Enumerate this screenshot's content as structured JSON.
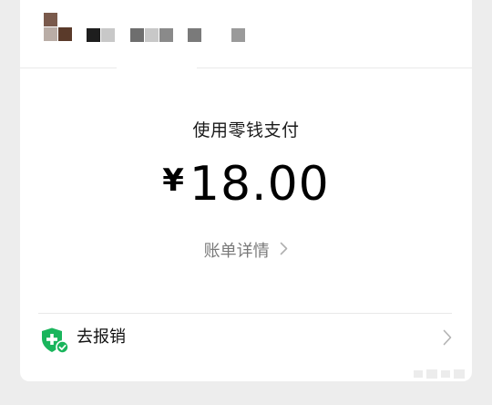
{
  "header": {
    "pixel_colors": [
      "#7a5a4c",
      "#b9ada6",
      "#5a3a2a",
      "#1e1e1e",
      "#c8c8c8",
      "#6e6e6e",
      "#c8c8c8",
      "#8a8a8a",
      "#7a7a7a",
      "#9a9a9a"
    ]
  },
  "payment": {
    "method": "使用零钱支付",
    "currency_symbol": "¥",
    "amount": "18.00",
    "details_link": "账单详情"
  },
  "reimburse": {
    "label": "去报销",
    "icon": "shield-plus-check-icon",
    "icon_color": "#07c160"
  },
  "colors": {
    "background": "#ededed",
    "card": "#ffffff",
    "accent_green": "#07c160"
  }
}
